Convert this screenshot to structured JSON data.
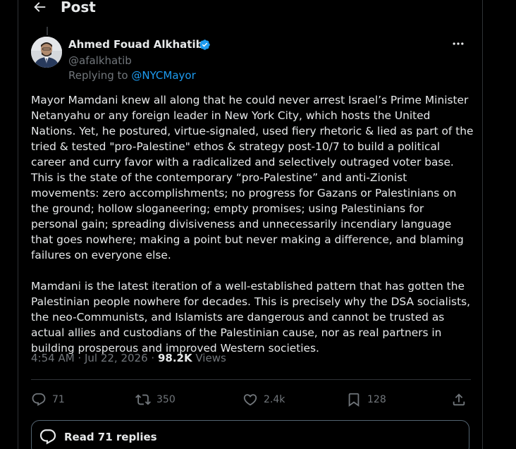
{
  "header": {
    "title": "Post"
  },
  "author": {
    "name": "Ahmed Fouad Alkhatib",
    "handle": "@afalkhatib",
    "replying_prefix": "Replying to",
    "replying_to": "@NYCMayor"
  },
  "post": {
    "paragraphs": [
      "Mayor Mamdani knew all along that he could never arrest Israel’s Prime Minister Netanyahu or any foreign leader in New York City, which hosts the United Nations. Yet, he postured, virtue-signaled, used fiery rhetoric & lied as part of the tried & tested \"pro-Palestine\" ethos & strategy post-10/7 to build a political career and curry favor with a radicalized and selectively outraged voter base. This is the state of the contemporary “pro-Palestine” and anti-Zionist movements: zero accomplishments; no progress for Gazans or Palestinians on the ground; hollow sloganeering; empty promises; using Palestinians for personal gain; spreading divisiveness and unnecessarily incendiary language that goes nowhere; making a point but never making a difference, and blaming failures on everyone else.",
      "Mamdani is the latest iteration of a well-established pattern that has gotten the Palestinian people nowhere for decades. This is precisely why the DSA socialists, the neo-Communists, and Islamists are dangerous and cannot be trusted as actual allies and custodians of the Palestinian cause, nor as real partners in building prosperous and improved Western societies."
    ],
    "timestamp": "4:54 AM · Jul 22, 2026 ·",
    "views_count": "98.2K",
    "views_label": "Views"
  },
  "actions": {
    "replies": "71",
    "reposts": "350",
    "likes": "2.4k",
    "bookmarks": "128"
  },
  "read_replies_label": "Read 71 replies",
  "colors": {
    "background": "#000000",
    "text": "#e7e9ea",
    "muted": "#71767b",
    "accent": "#1d9bf0",
    "border": "#2f3336"
  },
  "icons": [
    "back-arrow-icon",
    "verified-badge-icon",
    "more-icon",
    "reply-icon",
    "repost-icon",
    "like-icon",
    "bookmark-icon",
    "share-icon",
    "replies-bubble-icon"
  ]
}
